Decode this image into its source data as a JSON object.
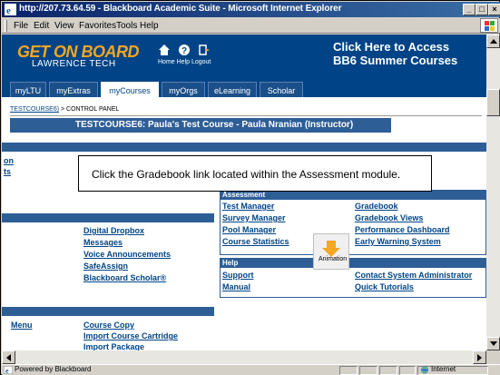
{
  "window": {
    "title": "http://207.73.64.59 - Blackboard Academic Suite - Microsoft Internet Explorer",
    "minimize": "_",
    "maximize": "□",
    "close": "×"
  },
  "menu": [
    "File",
    "Edit",
    "View",
    "Favorites",
    "Tools",
    "Help"
  ],
  "header": {
    "brand_line1": "GET ON BOARD",
    "brand_line2": "LAWRENCE TECH",
    "icon_links": "Home   Help  Logout",
    "promo_line1": "Click Here to Access",
    "promo_line2": "BB6 Summer Courses"
  },
  "tabs": [
    "myLTU",
    "myExtras",
    "myCourses",
    "myOrgs",
    "eLearning",
    "Scholar"
  ],
  "active_tab": "myCourses",
  "breadcrumb": {
    "course_id": "TESTCOURSE6)",
    "separator": " > ",
    "current": "CONTROL PANEL"
  },
  "course_title": "TESTCOURSE6: Paula's Test Course - Paula Nranian (Instructor)",
  "callout": "Click the Gradebook link located within the Assessment module.",
  "left_top_links": [
    "on",
    "ts"
  ],
  "left_mid_links": [
    "Digital Dropbox",
    "Messages",
    "Voice Announcements",
    "SafeAssign",
    "Blackboard Scholar®"
  ],
  "left_bottom_label": "Menu",
  "left_bottom_links": [
    "Course Copy",
    "Import Course Cartridge",
    "Import Package"
  ],
  "assessment": {
    "title": "Assessment",
    "left": [
      "Test Manager",
      "Survey Manager",
      "Pool Manager",
      "Course Statistics"
    ],
    "right": [
      "Gradebook",
      "Gradebook Views",
      "Performance Dashboard",
      "Early Warning System"
    ]
  },
  "help": {
    "title": "Help",
    "left": [
      "Support",
      "Manual"
    ],
    "right": [
      "Contact System Administrator",
      "Quick Tutorials"
    ]
  },
  "animation_label": "Animation",
  "status": {
    "text": "Powered by Blackboard",
    "zone": "Internet"
  },
  "colors": {
    "header_blue": "#004487",
    "module_blue": "#2e5e96",
    "brand_orange": "#f5a623",
    "link_blue": "#004487"
  }
}
